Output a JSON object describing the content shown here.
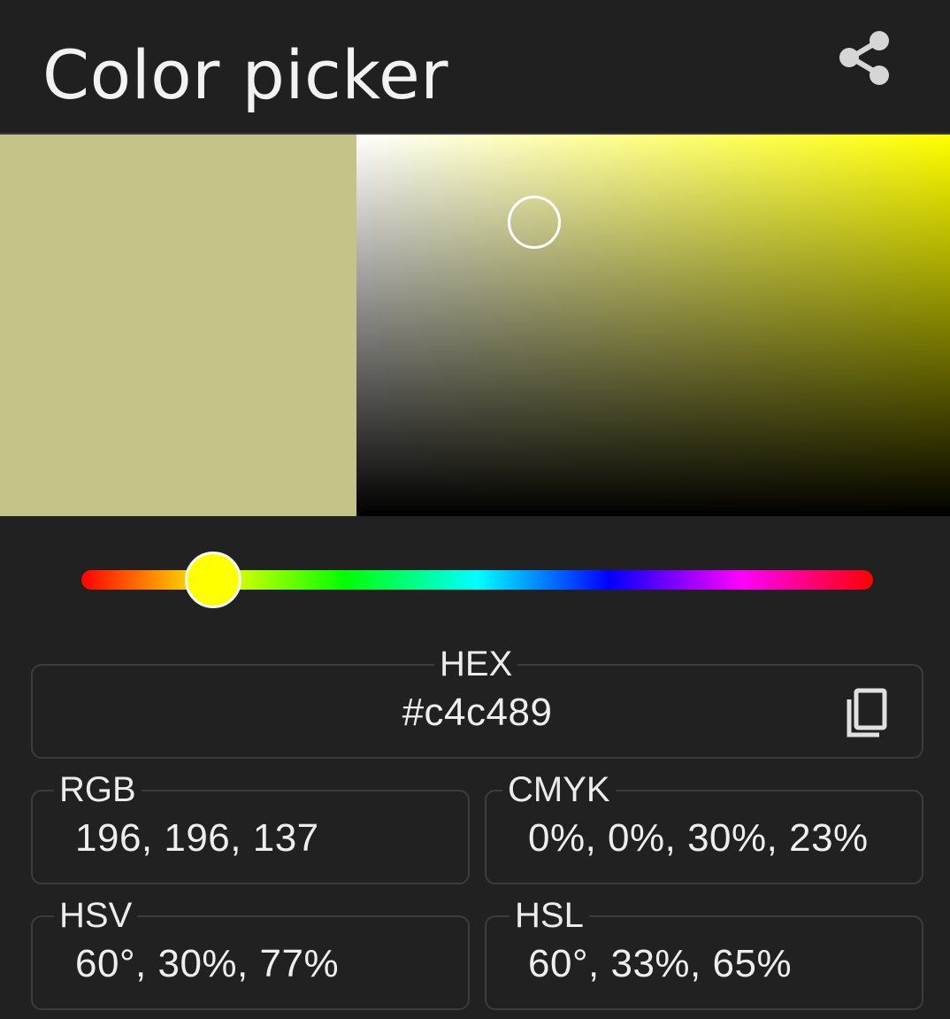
{
  "header": {
    "title": "Color picker",
    "share_icon": "share-icon"
  },
  "color": {
    "hex_value": "#c4c489",
    "hue_color": "#ffff00",
    "hue_degrees": 60,
    "saturation_fraction": 0.3,
    "value_fraction": 0.77
  },
  "fields": {
    "hex": {
      "label": "HEX",
      "value": "#c4c489",
      "copy_icon": "copy-icon"
    },
    "rgb": {
      "label": "RGB",
      "value": "196, 196, 137"
    },
    "cmyk": {
      "label": "CMYK",
      "value": "0%, 0%, 30%, 23%"
    },
    "hsv": {
      "label": "HSV",
      "value": "60°, 30%, 77%"
    },
    "hsl": {
      "label": "HSL",
      "value": "60°, 33%, 65%"
    }
  }
}
